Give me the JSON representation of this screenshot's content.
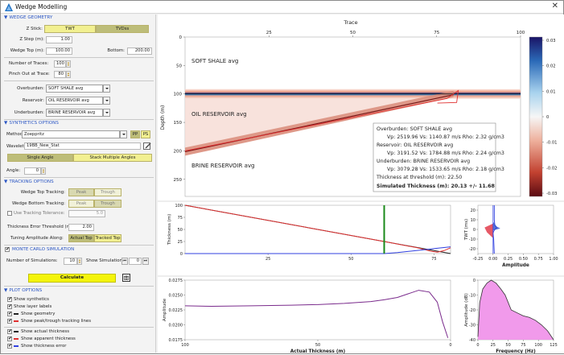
{
  "window": {
    "title": "Wedge Modelling",
    "close_label": "✕"
  },
  "sections": {
    "wedge_geometry": "WEDGE GEOMETRY",
    "synthetics_options": "SYNTHETICS OPTIONS",
    "tracking_options": "TRACKING OPTIONS",
    "monte_carlo": "MONTE CARLO SIMULATION",
    "plot_options": "PLOT OPTIONS"
  },
  "geometry": {
    "z_stick_label": "Z Stick:",
    "z_stick_options": [
      "TWT",
      "TVDss"
    ],
    "z_stick_selected": "TVDss",
    "z_step_label": "Z Step (m):",
    "z_step": "1.00",
    "wedge_top_label": "Wedge Top (m):",
    "wedge_top": "100.00",
    "bottom_label": "Bottom:",
    "bottom": "200.00",
    "num_traces_label": "Number of Traces:",
    "num_traces": "100",
    "pinch_out_label": "Pinch Out at Trace:",
    "pinch_out": "80",
    "overburden_label": "Overburden:",
    "overburden": "SOFT SHALE avg",
    "reservoir_label": "Reservoir:",
    "reservoir": "OIL RESERVOIR avg",
    "underburden_label": "Underburden:",
    "underburden": "BRINE RESERVOIR avg"
  },
  "synthetics": {
    "method_label": "Method:",
    "method": "Zoeppritz",
    "pp": "PP",
    "ps": "PS",
    "wavelet_label": "Wavelet:",
    "wavelet": "19BB_New_Stat",
    "single_angle": "Single Angle",
    "stack_multiple": "Stack Multiple Angles",
    "angle_label": "Angle:",
    "angle": "0"
  },
  "tracking": {
    "wedge_top_tracking_label": "Wedge Top Tracking:",
    "wedge_bottom_tracking_label": "Wedge Bottom Tracking:",
    "peak": "Peak",
    "trough": "Trough",
    "use_tolerance_label": "Use Tracking Tolerance:",
    "tolerance": "5.0",
    "thickness_error_label": "Thickness Error Threshold (m):",
    "thickness_error": "2.00",
    "tuning_amp_label": "Tuning Amplitude Along:",
    "actual_top": "Actual Top",
    "tracked_top": "Tracked Top"
  },
  "monte_carlo": {
    "num_sims_label": "Number of Simulations:",
    "num_sims": "10",
    "show_sim_label": "Show Simulation:",
    "show_sim": "0"
  },
  "calculate_label": "Calculate",
  "plot_options": [
    {
      "label": "Show synthetics",
      "checked": true,
      "color": ""
    },
    {
      "label": "Show layer labels",
      "checked": true,
      "color": ""
    },
    {
      "label": "Show geometry",
      "checked": true,
      "color": "#222222"
    },
    {
      "label": "Show peak/trough tracking lines",
      "checked": true,
      "color": "#e03030"
    },
    {
      "label": "Show actual thickness",
      "checked": true,
      "color": "#222222"
    },
    {
      "label": "Show apparent thickness",
      "checked": true,
      "color": "#e03030"
    },
    {
      "label": "Show thickness error",
      "checked": true,
      "color": "#3040e0"
    }
  ],
  "seismic": {
    "title": "Trace",
    "x_ticks": [
      "25",
      "50",
      "75",
      "100"
    ],
    "y_ticks": [
      "0",
      "50",
      "100",
      "150",
      "200",
      "250"
    ],
    "ylabel": "Depth (m)",
    "layer_labels": [
      "SOFT SHALE avg",
      "OIL RESERVOIR avg",
      "BRINE RESERVOIR avg"
    ],
    "colorbar_ticks": [
      "0.03",
      "0.02",
      "0.01",
      "0",
      "-0.01",
      "-0.02",
      "-0.03"
    ]
  },
  "info_box": {
    "line1": "Overburden: SOFT SHALE avg",
    "line2": "Vp: 2519.96 Vs: 1140.87 m/s Rho: 2.32 g/cm3",
    "line3": "Reservoir: OIL RESERVOIR avg",
    "line4": "Vp: 3191.52 Vs: 1784.88 m/s Rho: 2.24 g/cm3",
    "line5": "Underburden: BRINE RESERVOIR avg",
    "line6": "Vp: 3079.28 Vs: 1533.65 m/s Rho: 2.18 g/cm3",
    "line7": "Thickness at threshold (m): 22.50",
    "line8": "Simulated Thickness (m): 20.13 +/- 11.68"
  },
  "thickness_plot": {
    "ylabel": "Thickness (m)",
    "y_ticks": [
      "100",
      "75",
      "50",
      "25",
      "0"
    ],
    "x_ticks": [
      "25",
      "50",
      "75"
    ]
  },
  "twt_plot": {
    "ylabel": "TWT (ms)",
    "xlabel": "Amplitude",
    "y_ticks": [
      "20",
      "10",
      "0",
      "-10",
      "-20"
    ],
    "x_ticks": [
      "-0.25",
      "0.00",
      "0.25",
      "0.50",
      "0.75",
      "1.00"
    ]
  },
  "amplitude_plot": {
    "ylabel": "Amplitude",
    "xlabel": "Actual Thickness (m)",
    "y_ticks": [
      "0.0275",
      "0.0250",
      "0.0225",
      "0.0200",
      "0.0175"
    ],
    "x_ticks": [
      "100",
      "50",
      "0"
    ]
  },
  "spectrum_plot": {
    "ylabel": "Amplitude (dB)",
    "xlabel": "Frequency (Hz)",
    "y_ticks": [
      "0",
      "-10",
      "-20",
      "-30",
      "-40"
    ],
    "x_ticks": [
      "0",
      "25",
      "50",
      "75",
      "100",
      "125"
    ]
  },
  "chart_data": [
    {
      "type": "line",
      "title": "",
      "xlabel": "",
      "ylabel": "Thickness (m)",
      "xlim": [
        0,
        80
      ],
      "ylim": [
        0,
        100
      ],
      "series": [
        {
          "name": "",
          "color": "#222222",
          "x": [
            0,
            80
          ],
          "y": [
            100,
            0
          ]
        },
        {
          "name": "",
          "color": "#e03030",
          "x": [
            0,
            60,
            70,
            74,
            76,
            78,
            80
          ],
          "y": [
            100,
            25,
            12,
            5,
            3,
            6,
            12
          ]
        },
        {
          "name": "",
          "color": "#3040e0",
          "x": [
            0,
            60,
            64,
            68,
            72,
            76,
            80
          ],
          "y": [
            0,
            0,
            2,
            5,
            8,
            11,
            14
          ]
        }
      ],
      "vline_x": 60
    },
    {
      "type": "line",
      "title": "",
      "xlabel": "Amplitude",
      "ylabel": "TWT (ms)",
      "xlim": [
        -0.25,
        1.0
      ],
      "ylim": [
        -25,
        25
      ],
      "series": [
        {
          "name": "",
          "color": "#3040e0",
          "x": [
            0.02,
            0.02,
            0.03,
            0.06,
            0.03,
            0.01,
            0.0,
            0.01,
            0.02
          ],
          "y": [
            25,
            10,
            4,
            2,
            0,
            -2,
            -4,
            -10,
            -25
          ]
        }
      ],
      "fill_positive": "#3050d0",
      "fill_negative": "#e03040"
    },
    {
      "type": "line",
      "title": "",
      "xlabel": "Actual Thickness (m)",
      "ylabel": "Amplitude",
      "xlim": [
        100,
        0
      ],
      "ylim": [
        0.0175,
        0.0275
      ],
      "series": [
        {
          "name": "",
          "color": "#7a2b8c",
          "x": [
            100,
            90,
            75,
            60,
            50,
            40,
            30,
            25,
            20,
            16,
            12,
            8,
            5,
            3,
            1
          ],
          "y": [
            0.0232,
            0.0231,
            0.0232,
            0.0233,
            0.0234,
            0.0236,
            0.0239,
            0.0242,
            0.0246,
            0.0252,
            0.0258,
            0.0255,
            0.0238,
            0.0205,
            0.0178
          ]
        }
      ]
    },
    {
      "type": "area",
      "title": "",
      "xlabel": "Frequency (Hz)",
      "ylabel": "Amplitude (dB)",
      "xlim": [
        0,
        125
      ],
      "ylim": [
        -40,
        0
      ],
      "series": [
        {
          "name": "",
          "color": "#ee88e8",
          "x": [
            0,
            3,
            8,
            15,
            22,
            30,
            38,
            45,
            55,
            65,
            75,
            85,
            95,
            105,
            115,
            125
          ],
          "y": [
            -38,
            -15,
            -6,
            -2,
            0,
            -2,
            -6,
            -10,
            -20,
            -22,
            -24,
            -25,
            -27,
            -30,
            -34,
            -40
          ]
        }
      ]
    }
  ]
}
